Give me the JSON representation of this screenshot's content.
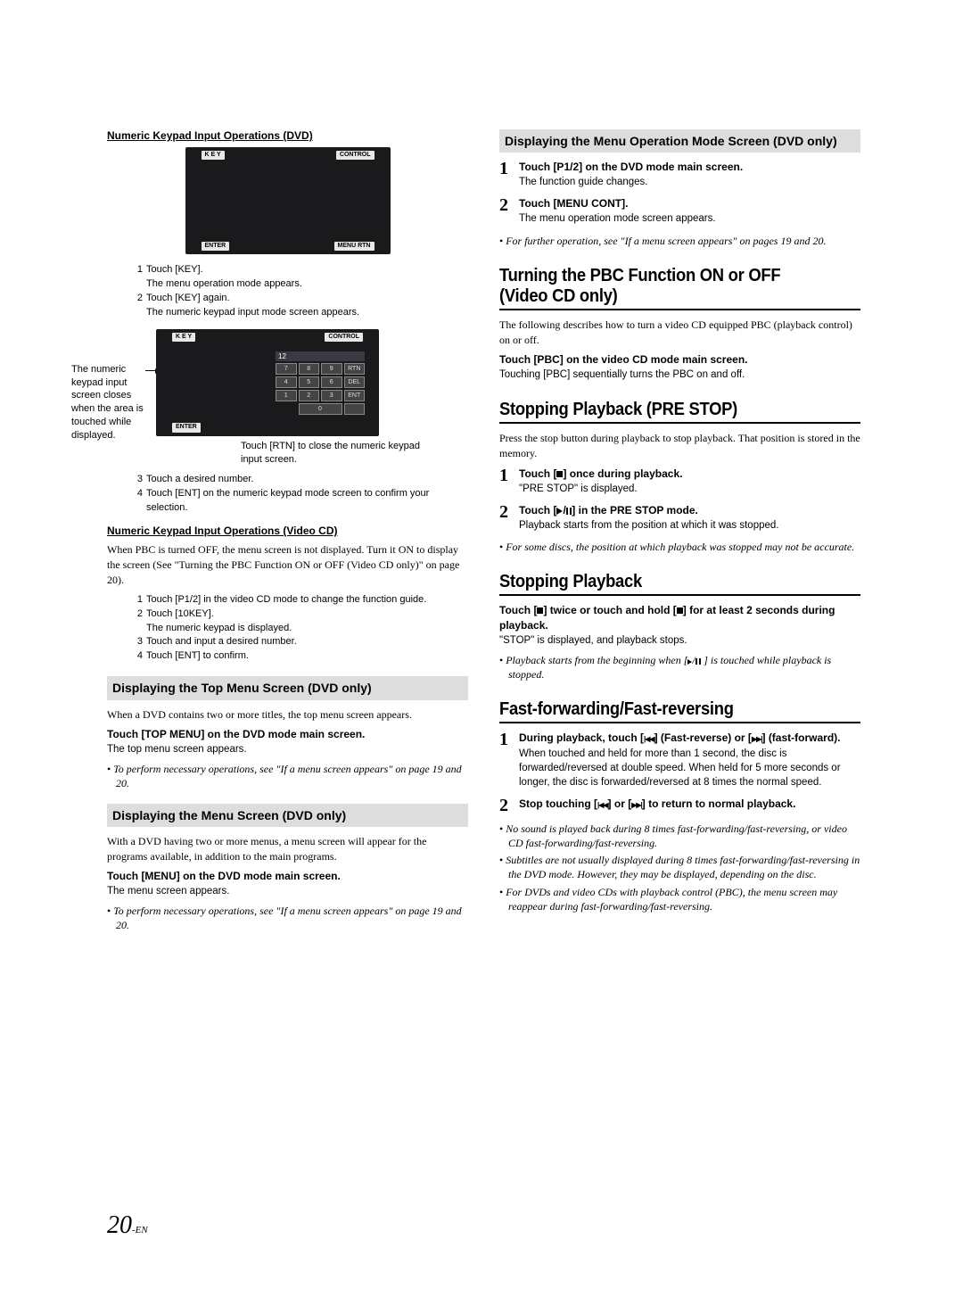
{
  "left": {
    "h_keypad_dvd": "Numeric Keypad Input Operations (DVD)",
    "shot_btns": {
      "key": "K E Y",
      "control": "CONTROL",
      "enter": "ENTER",
      "menurtn": "MENU RTN"
    },
    "steps1": {
      "s1a": "Touch [KEY].",
      "s1b": "The menu operation mode appears.",
      "s2a": "Touch [KEY] again.",
      "s2b": "The numeric keypad input mode screen appears."
    },
    "side_note": "The numeric keypad input screen closes when the area is touched while displayed.",
    "keypad": {
      "disp": "12",
      "keys": [
        "7",
        "8",
        "9",
        "RTN",
        "4",
        "5",
        "6",
        "DEL",
        "1",
        "2",
        "3",
        "ENT",
        "0"
      ]
    },
    "rtn_note": "Touch [RTN] to close the numeric keypad input screen.",
    "steps2": {
      "s3": "Touch a desired number.",
      "s4": "Touch [ENT] on the numeric keypad mode screen to confirm your selection."
    },
    "h_keypad_vcd": "Numeric Keypad Input Operations (Video CD)",
    "vcd_body": "When PBC is turned OFF, the menu screen is not displayed. Turn it ON to display the screen (See \"Turning the PBC Function ON or OFF (Video CD only)\" on page 20).",
    "steps3": {
      "s1": "Touch [P1/2] in the video CD mode to change the function guide.",
      "s2a": "Touch [10KEY].",
      "s2b": "The numeric keypad is displayed.",
      "s3": "Touch and input a desired number.",
      "s4": "Touch [ENT] to confirm."
    },
    "grey_topmenu": "Displaying the Top Menu Screen (DVD only)",
    "topmenu_body": "When a DVD contains two or more titles, the top menu screen appears.",
    "topmenu_bold": "Touch [TOP MENU] on the DVD mode main screen.",
    "topmenu_sub": "The top menu screen appears.",
    "topmenu_note": "To perform necessary operations, see \"If a menu screen appears\" on page 19 and 20.",
    "grey_menu": "Displaying the Menu Screen (DVD only)",
    "menu_body": "With a DVD having two or more menus, a menu screen will appear for the programs available, in addition to the main programs.",
    "menu_bold": "Touch [MENU] on the DVD mode main screen.",
    "menu_sub": "The menu screen appears.",
    "menu_note": "To perform necessary operations, see \"If a menu screen appears\" on page 19 and 20."
  },
  "right": {
    "grey_menumode": "Displaying the Menu Operation Mode Screen (DVD only)",
    "menumode": {
      "s1bold": "Touch [P1/2] on the DVD mode main screen.",
      "s1sub": "The function guide changes.",
      "s2bold": "Touch [MENU CONT].",
      "s2sub": "The menu operation mode screen appears.",
      "note": "For further operation, see \"If a menu screen appears\" on  pages 19 and 20."
    },
    "title_pbc": "Turning the PBC Function ON or OFF (Video CD only)",
    "pbc_body": "The following describes how to turn a video CD equipped PBC (playback control) on or off.",
    "pbc_bold": "Touch [PBC] on the video CD mode main screen.",
    "pbc_sub": "Touching [PBC] sequentially turns the PBC on and off.",
    "title_prestop": "Stopping Playback (PRE STOP)",
    "prestop_body": "Press the stop button during playback to stop playback.  That position is stored in the memory.",
    "prestop": {
      "s1bold_a": "Touch [",
      "s1bold_b": "] once during playback.",
      "s1sub": "\"PRE STOP\" is displayed.",
      "s2bold_a": "Touch [",
      "s2bold_b": "] in the PRE STOP mode.",
      "s2sub": "Playback starts from the position at which it was stopped.",
      "note": "For some discs, the position at which playback was stopped may not be accurate."
    },
    "title_stop": "Stopping Playback",
    "stop_bold_a": "Touch [",
    "stop_bold_b": "] twice or touch and hold [",
    "stop_bold_c": "] for at least 2 seconds during playback.",
    "stop_sub": "\"STOP\" is displayed, and playback stops.",
    "stop_note_a": "Playback starts from the beginning when [",
    "stop_note_b": " ] is touched while playback is stopped.",
    "title_ff": "Fast-forwarding/Fast-reversing",
    "ff": {
      "s1bold_a": "During playback, touch [",
      "s1bold_b": "] (Fast-reverse) or [",
      "s1bold_c": "] (fast-forward).",
      "s1sub": "When touched and held for more than 1 second, the disc is forwarded/reversed at double speed. When held for 5 more seconds or longer, the disc is forwarded/reversed at 8 times the normal speed.",
      "s2bold_a": "Stop touching [",
      "s2bold_b": "] or [",
      "s2bold_c": "] to return to normal playback.",
      "notes": [
        "No sound is played back during 8 times fast-forwarding/fast-reversing, or video CD fast-forwarding/fast-reversing.",
        "Subtitles are not usually displayed during 8 times fast-forwarding/fast-reversing in the DVD mode. However, they may be displayed, depending on the disc.",
        "For DVDs and video CDs with playback control (PBC), the menu screen may reappear during fast-forwarding/fast-reversing."
      ]
    }
  },
  "page_number": "20",
  "page_suffix": "-EN"
}
